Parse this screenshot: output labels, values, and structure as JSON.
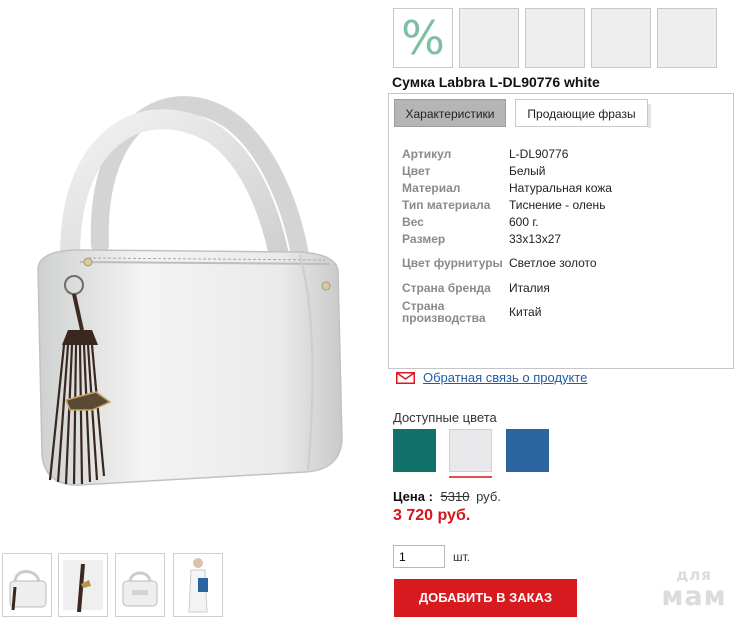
{
  "badges": [
    {
      "icon": "percent-icon",
      "text": "%"
    },
    {
      "icon": "empty-badge"
    },
    {
      "icon": "empty-badge"
    },
    {
      "icon": "empty-badge"
    },
    {
      "icon": "empty-badge"
    }
  ],
  "product": {
    "title": "Сумка Labbra L-DL90776 white"
  },
  "tabs": [
    {
      "label": "Характеристики",
      "active": true
    },
    {
      "label": "Продающие фразы",
      "active": false
    }
  ],
  "specs": [
    {
      "label": "Артикул",
      "value": "L-DL90776"
    },
    {
      "label": "Цвет",
      "value": "Белый"
    },
    {
      "label": "Материал",
      "value": "Натуральная кожа"
    },
    {
      "label": "Тип материала",
      "value": "Тиснение - олень"
    },
    {
      "label": "Вес",
      "value": "600 г."
    },
    {
      "label": "Размер",
      "value": "33х13х27"
    },
    {
      "label": "Цвет фурнитуры",
      "value": "Светлое золото"
    },
    {
      "label": "Страна бренда",
      "value": "Италия"
    },
    {
      "label": "Страна производства",
      "value": "Китай"
    }
  ],
  "feedback": {
    "icon": "envelope-icon",
    "label": "Обратная связь о продукте"
  },
  "colors": {
    "title": "Доступные цвета",
    "swatches": [
      {
        "name": "teal",
        "color": "#11706a"
      },
      {
        "name": "white",
        "color": "#e9e9ec",
        "selected": true
      },
      {
        "name": "blue",
        "color": "#2b64a0"
      }
    ],
    "selected_indicator_color": "#e35050"
  },
  "price": {
    "label": "Цена :",
    "old_value": "5310",
    "currency": "руб.",
    "new_price": "3 720 руб.",
    "new_price_color": "#d6141c"
  },
  "quantity": {
    "value": "1",
    "unit": "шт."
  },
  "add_button": {
    "label": "ДОБАВИТЬ В ЗАКАЗ",
    "color": "#d71920"
  },
  "thumbnails": [
    "bag-front",
    "bag-side-tassel",
    "bag-back",
    "bag-on-model"
  ],
  "watermark": {
    "top": "для",
    "bottom": "мам"
  }
}
